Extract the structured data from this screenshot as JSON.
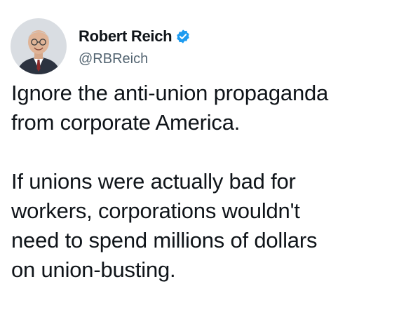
{
  "author": {
    "display_name": "Robert Reich",
    "handle": "@RBReich",
    "verified": true,
    "avatar_icon": "profile-photo-icon",
    "verified_icon": "verified-badge-icon"
  },
  "tweet": {
    "paragraph_1_line_1": "Ignore the anti-union propaganda",
    "paragraph_1_line_2": "from corporate America.",
    "paragraph_2_line_1": "If unions were actually bad for",
    "paragraph_2_line_2": "workers, corporations wouldn't",
    "paragraph_2_line_3": "need to spend millions of dollars",
    "paragraph_2_line_4": "on union-busting."
  },
  "colors": {
    "text": "#0f1419",
    "handle": "#536471",
    "verified_blue": "#1d9bf0",
    "background": "#ffffff"
  }
}
